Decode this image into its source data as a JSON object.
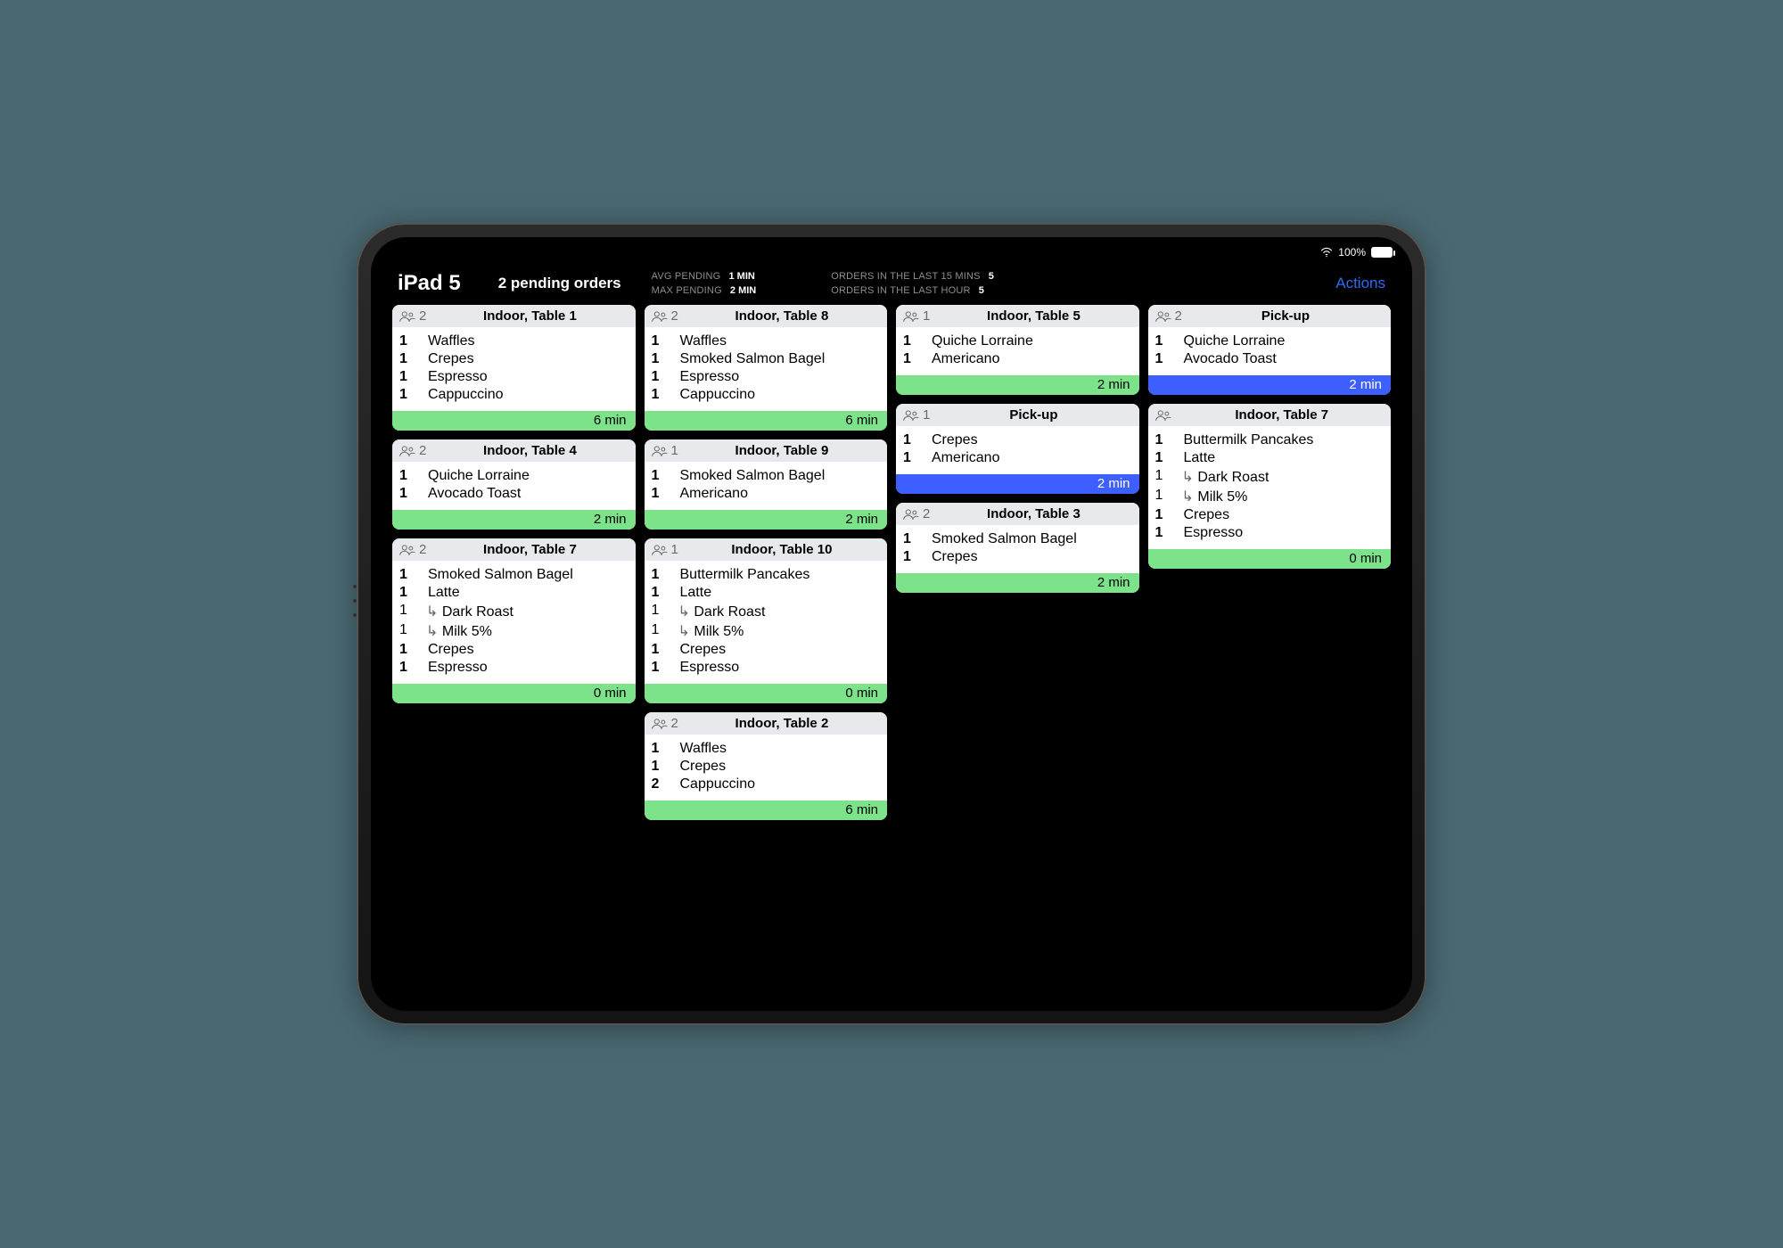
{
  "statusbar": {
    "battery": "100%"
  },
  "header": {
    "app_title": "iPad 5",
    "pending_summary": "2 pending orders",
    "stats": {
      "avg_pending_label": "AVG PENDING",
      "avg_pending_value": "1 MIN",
      "max_pending_label": "MAX PENDING",
      "max_pending_value": "2 MIN",
      "orders_15_label": "ORDERS IN THE LAST 15 MINS",
      "orders_15_value": "5",
      "orders_hour_label": "ORDERS IN THE LAST HOUR",
      "orders_hour_value": "5"
    },
    "actions_label": "Actions"
  },
  "columns": [
    [
      {
        "people": "2",
        "title": "Indoor, Table 1",
        "items": [
          {
            "qty": "1",
            "name": "Waffles"
          },
          {
            "qty": "1",
            "name": "Crepes"
          },
          {
            "qty": "1",
            "name": "Espresso"
          },
          {
            "qty": "1",
            "name": "Cappuccino"
          }
        ],
        "time": "6 min",
        "footer": "green"
      },
      {
        "people": "2",
        "title": "Indoor, Table 4",
        "items": [
          {
            "qty": "1",
            "name": "Quiche Lorraine"
          },
          {
            "qty": "1",
            "name": "Avocado Toast"
          }
        ],
        "time": "2 min",
        "footer": "green"
      },
      {
        "people": "2",
        "title": "Indoor, Table 7",
        "items": [
          {
            "qty": "1",
            "name": "Smoked Salmon Bagel"
          },
          {
            "qty": "1",
            "name": "Latte"
          },
          {
            "qty": "1",
            "name": "Dark Roast",
            "mod": true
          },
          {
            "qty": "1",
            "name": "Milk 5%",
            "mod": true
          },
          {
            "qty": "1",
            "name": "Crepes"
          },
          {
            "qty": "1",
            "name": "Espresso"
          }
        ],
        "time": "0 min",
        "footer": "green"
      }
    ],
    [
      {
        "people": "2",
        "title": "Indoor, Table 8",
        "items": [
          {
            "qty": "1",
            "name": "Waffles"
          },
          {
            "qty": "1",
            "name": "Smoked Salmon Bagel"
          },
          {
            "qty": "1",
            "name": "Espresso"
          },
          {
            "qty": "1",
            "name": "Cappuccino"
          }
        ],
        "time": "6 min",
        "footer": "green"
      },
      {
        "people": "1",
        "title": "Indoor, Table 9",
        "items": [
          {
            "qty": "1",
            "name": "Smoked Salmon Bagel"
          },
          {
            "qty": "1",
            "name": "Americano"
          }
        ],
        "time": "2 min",
        "footer": "green"
      },
      {
        "people": "1",
        "title": "Indoor, Table 10",
        "items": [
          {
            "qty": "1",
            "name": "Buttermilk Pancakes"
          },
          {
            "qty": "1",
            "name": "Latte"
          },
          {
            "qty": "1",
            "name": "Dark Roast",
            "mod": true
          },
          {
            "qty": "1",
            "name": "Milk 5%",
            "mod": true
          },
          {
            "qty": "1",
            "name": "Crepes"
          },
          {
            "qty": "1",
            "name": "Espresso"
          }
        ],
        "time": "0 min",
        "footer": "green"
      },
      {
        "people": "2",
        "title": "Indoor, Table 2",
        "items": [
          {
            "qty": "1",
            "name": "Waffles"
          },
          {
            "qty": "1",
            "name": "Crepes"
          },
          {
            "qty": "2",
            "name": "Cappuccino"
          }
        ],
        "time": "6 min",
        "footer": "green"
      }
    ],
    [
      {
        "people": "1",
        "title": "Indoor, Table 5",
        "items": [
          {
            "qty": "1",
            "name": "Quiche Lorraine"
          },
          {
            "qty": "1",
            "name": "Americano"
          }
        ],
        "time": "2 min",
        "footer": "green"
      },
      {
        "people": "1",
        "title": "Pick-up",
        "items": [
          {
            "qty": "1",
            "name": "Crepes"
          },
          {
            "qty": "1",
            "name": "Americano"
          }
        ],
        "time": "2 min",
        "footer": "blue"
      },
      {
        "people": "2",
        "title": "Indoor, Table 3",
        "items": [
          {
            "qty": "1",
            "name": "Smoked Salmon Bagel"
          },
          {
            "qty": "1",
            "name": "Crepes"
          }
        ],
        "time": "2 min",
        "footer": "green"
      }
    ],
    [
      {
        "people": "2",
        "title": "Pick-up",
        "items": [
          {
            "qty": "1",
            "name": "Quiche Lorraine"
          },
          {
            "qty": "1",
            "name": "Avocado Toast"
          }
        ],
        "time": "2 min",
        "footer": "blue"
      },
      {
        "people": "",
        "title": "Indoor, Table 7",
        "items": [
          {
            "qty": "1",
            "name": "Buttermilk Pancakes"
          },
          {
            "qty": "1",
            "name": "Latte"
          },
          {
            "qty": "1",
            "name": "Dark Roast",
            "mod": true
          },
          {
            "qty": "1",
            "name": "Milk 5%",
            "mod": true
          },
          {
            "qty": "1",
            "name": "Crepes"
          },
          {
            "qty": "1",
            "name": "Espresso"
          }
        ],
        "time": "0 min",
        "footer": "green"
      }
    ]
  ]
}
